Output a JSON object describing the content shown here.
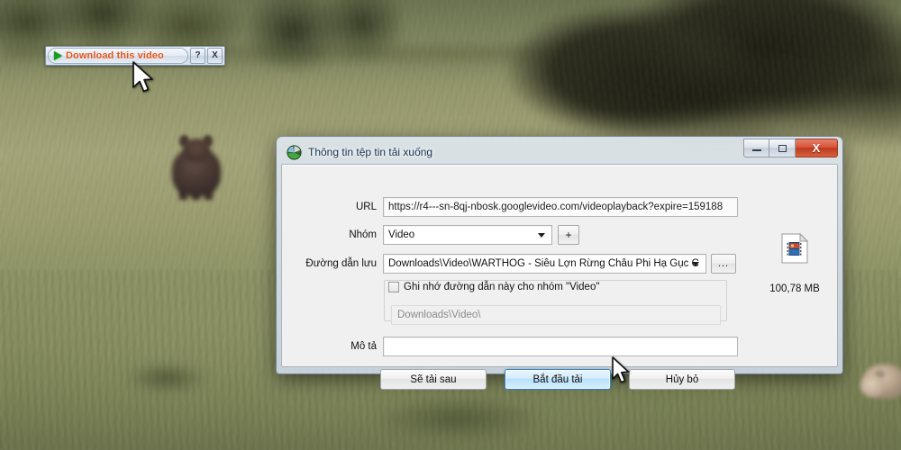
{
  "video_overlay": {
    "download_button_label": "Download this video",
    "play_icon": "play-triangle-icon",
    "help_button_label": "?",
    "close_button_label": "X"
  },
  "dialog": {
    "title": "Thông tin tệp tin tải xuống",
    "app_icon": "idm-globe-icon",
    "window_controls": {
      "minimize": "minimize-icon",
      "maximize": "maximize-icon",
      "close": "X"
    },
    "fields": {
      "url_label": "URL",
      "url_value": "https://r4---sn-8qj-nbosk.googlevideo.com/videoplayback?expire=159188",
      "category_label": "Nhóm",
      "category_value": "Video",
      "add_category_label": "+",
      "save_path_label": "Đường dẫn lưu",
      "save_path_value": "Downloads\\Video\\WARTHOG - Siêu Lợn Rừng Châu Phi Hạ Gục C",
      "browse_label": "...",
      "remember_checkbox_label": "Ghi nhớ đường dẫn này cho nhóm \"Video\"",
      "remember_checked": false,
      "path_preview_value": "Downloads\\Video\\",
      "description_label": "Mô tả",
      "description_value": ""
    },
    "file": {
      "icon": "video-file-icon",
      "size": "100,78  MB"
    },
    "buttons": {
      "download_later": "Sẽ tải sau",
      "start_download": "Bắt đầu tải",
      "cancel": "Hủy bỏ"
    }
  },
  "colors": {
    "accent_orange": "#e8551a",
    "play_green": "#16a018",
    "primary_button_blue": "#b6e0fb",
    "close_red": "#d4543a"
  }
}
